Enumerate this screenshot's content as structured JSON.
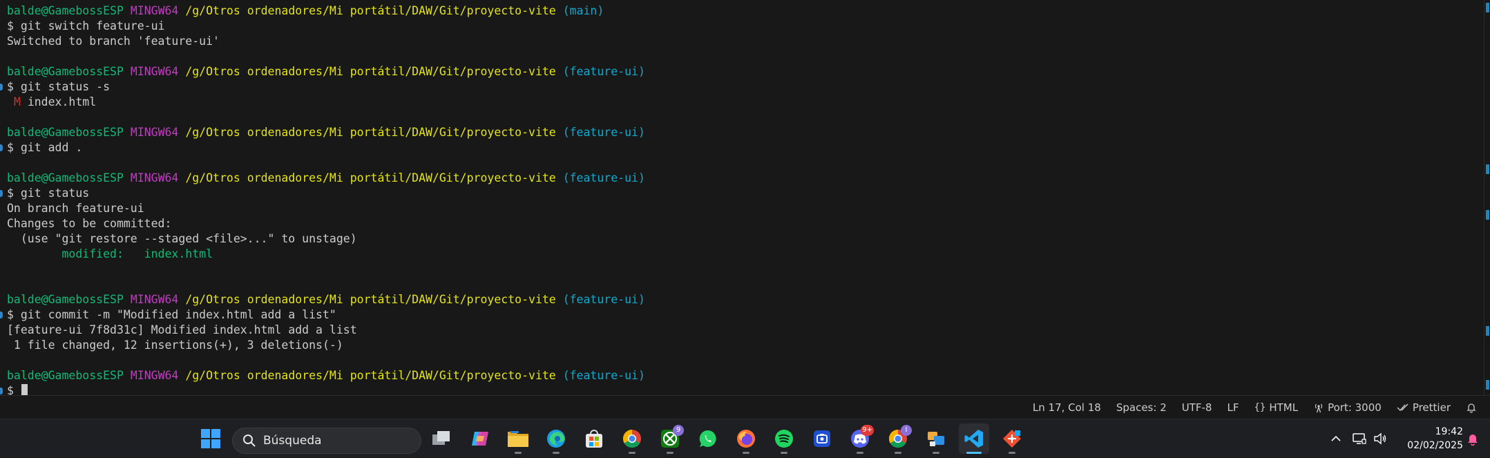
{
  "terminal": {
    "prompt": {
      "user_host": "balde@GamebossESP",
      "system": "MINGW64",
      "path": "/g/Otros ordenadores/Mi portátil/DAW/Git/proyecto-vite"
    },
    "blocks": [
      {
        "branch": "(main)",
        "command": "$ git switch feature-ui",
        "output": [
          "Switched to branch 'feature-ui'"
        ]
      },
      {
        "branch": "(feature-ui)",
        "command": "$ git status -s",
        "status_short": {
          "flag": "M",
          "file": "index.html"
        }
      },
      {
        "branch": "(feature-ui)",
        "command": "$ git add ."
      },
      {
        "branch": "(feature-ui)",
        "command": "$ git status",
        "output": [
          "On branch feature-ui",
          "Changes to be committed:",
          "  (use \"git restore --staged <file>...\" to unstage)"
        ],
        "staged": "        modified:   index.html"
      },
      {
        "branch": "(feature-ui)",
        "command": "$ git commit -m \"Modified index.html add a list\"",
        "output": [
          "[feature-ui 7f8d31c] Modified index.html add a list",
          " 1 file changed, 12 insertions(+), 3 deletions(-)"
        ]
      },
      {
        "branch": "(feature-ui)",
        "command": "$ "
      }
    ]
  },
  "statusbar": {
    "position": "Ln 17, Col 18",
    "spaces": "Spaces: 2",
    "encoding": "UTF-8",
    "eol": "LF",
    "language": "HTML",
    "port": "Port: 3000",
    "formatter": "Prettier",
    "icons": {
      "language": "braces-icon",
      "port": "broadcast-icon",
      "formatter": "double-check-icon",
      "notifications": "bell-icon"
    }
  },
  "taskbar": {
    "search_placeholder": "Búsqueda",
    "apps": [
      {
        "name": "start",
        "icon": "windows-logo-icon"
      },
      {
        "name": "task-view",
        "icon": "task-view-icon"
      },
      {
        "name": "copilot",
        "icon": "copilot-icon"
      },
      {
        "name": "file-explorer",
        "icon": "folder-icon"
      },
      {
        "name": "edge",
        "icon": "edge-icon"
      },
      {
        "name": "store",
        "icon": "store-icon"
      },
      {
        "name": "chrome",
        "icon": "chrome-icon"
      },
      {
        "name": "xbox",
        "icon": "xbox-icon",
        "badge": "9"
      },
      {
        "name": "whatsapp",
        "icon": "whatsapp-icon"
      },
      {
        "name": "firefox",
        "icon": "firefox-icon"
      },
      {
        "name": "spotify",
        "icon": "spotify-icon"
      },
      {
        "name": "screen-capture",
        "icon": "capture-icon"
      },
      {
        "name": "discord",
        "icon": "discord-icon",
        "badge": "9+"
      },
      {
        "name": "chrome-profile",
        "icon": "chrome-icon",
        "badge": "I"
      },
      {
        "name": "app-grid",
        "icon": "app-icon"
      },
      {
        "name": "vscode",
        "icon": "vscode-icon",
        "active": true
      },
      {
        "name": "git-gui",
        "icon": "git-gui-icon"
      }
    ],
    "tray": {
      "clock_time": "19:42",
      "clock_date": "02/02/2025"
    },
    "colors": {
      "taskbar_bg": "#1e1f22",
      "accent": "#4cc2ff"
    }
  },
  "theme": {
    "terminal_bg": "#181818",
    "text": "#cccccc",
    "user": "#0dbc79",
    "system": "#bc3fbc",
    "path": "#e5e510",
    "branch": "#11a8cd",
    "modified_flag": "#cd3131"
  }
}
